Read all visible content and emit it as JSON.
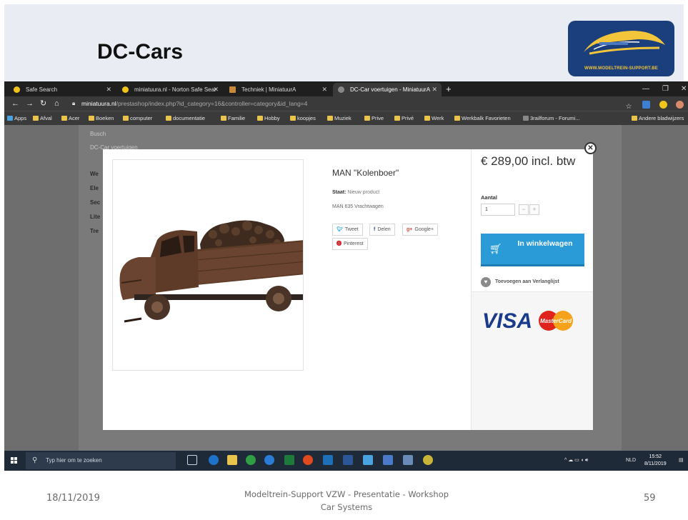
{
  "slide": {
    "title": "DC-Cars",
    "logo_text": "WWW.MODELTREIN-SUPPORT.BE",
    "footer_date": "18/11/2019",
    "footer_center": "Modeltrein-Support  VZW - Presentatie - Workshop  Car Systems",
    "footer_page": "59"
  },
  "browser": {
    "tabs": [
      {
        "label": "Safe Search",
        "active": false
      },
      {
        "label": "miniatuura.nl - Norton Safe Sear",
        "active": false
      },
      {
        "label": "Techniek | MiniatuurA",
        "active": false
      },
      {
        "label": "DC-Car voertuigen - MiniatuurA",
        "active": true
      }
    ],
    "new_tab": "+",
    "url_domain": "miniatuura.nl",
    "url_path": "/prestashop/index.php?id_category=16&controller=category&id_lang=4",
    "bookmarks": [
      "Apps",
      "Afval",
      "Acer",
      "Boeken",
      "computer",
      "documentatie",
      "Familie",
      "Hobby",
      "koopjes",
      "Muziek",
      "Prive",
      "Privé",
      "Werk",
      "Werkbalk Favorieten",
      "3railforum - Forumi...",
      "Andere bladwijzers"
    ],
    "categories_bg": [
      "Busch",
      "DC-Car voertuigen",
      "We",
      "Ele",
      "Sec",
      "Lite",
      "Tre"
    ]
  },
  "modal": {
    "product_name": "MAN \"Kolenboer\"",
    "staat_label": "Staat:",
    "staat_value": "Nieuw product",
    "description": "MAN 635 Vrachtwagen",
    "share": {
      "tweet": "Tweet",
      "delen": "Delen",
      "google": "Google+",
      "pinterest": "Pinterest"
    },
    "price": "€ 289,00 incl. btw",
    "quantity_label": "Aantal",
    "quantity_value": "1",
    "minus": "−",
    "plus": "+",
    "cart_button": "In winkelwagen",
    "wishlist": "Toevoegen aan Verlanglijst",
    "visa": "VISA",
    "mastercard": "MasterCard"
  },
  "taskbar": {
    "search_placeholder": "Typ hier om te zoeken",
    "language": "NLD",
    "time": "15:52",
    "date": "8/11/2019"
  }
}
